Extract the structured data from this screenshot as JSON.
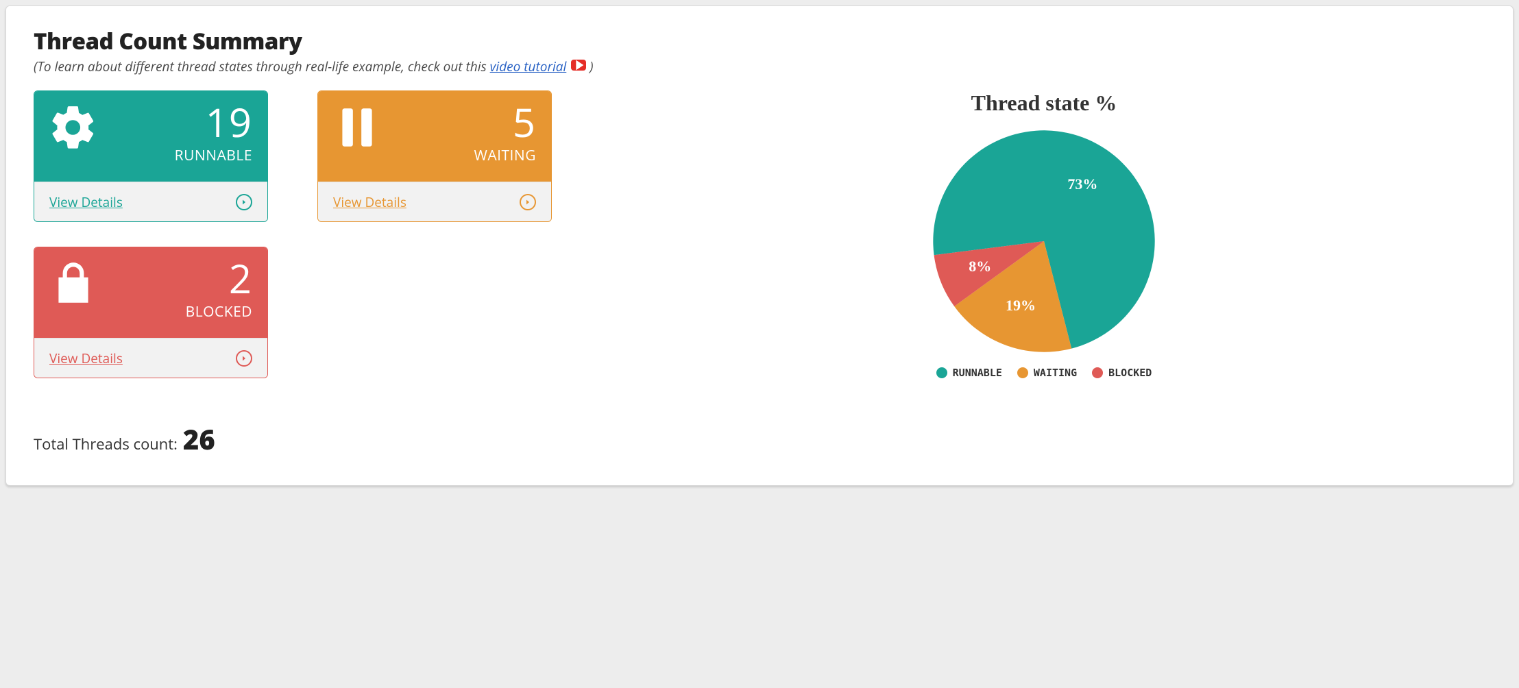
{
  "header": {
    "title": "Thread Count Summary",
    "subtitle_prefix": "(To learn about different thread states through real-life example, check out this ",
    "subtitle_link": "video tutorial",
    "subtitle_suffix": ")"
  },
  "colors": {
    "runnable": "#1aa596",
    "waiting": "#e79632",
    "blocked": "#df5a56"
  },
  "tiles": {
    "runnable": {
      "count": "19",
      "label": "RUNNABLE",
      "details": "View Details"
    },
    "waiting": {
      "count": "5",
      "label": "WAITING",
      "details": "View Details"
    },
    "blocked": {
      "count": "2",
      "label": "BLOCKED",
      "details": "View Details"
    }
  },
  "total": {
    "label": "Total Threads count:",
    "value": "26"
  },
  "chart_data": {
    "type": "pie",
    "title": "Thread state %",
    "series": [
      {
        "name": "RUNNABLE",
        "value": 73,
        "label": "73%",
        "color": "#1aa596"
      },
      {
        "name": "WAITING",
        "value": 19,
        "label": "19%",
        "color": "#e79632"
      },
      {
        "name": "BLOCKED",
        "value": 8,
        "label": "8%",
        "color": "#df5a56"
      }
    ],
    "legend": [
      "RUNNABLE",
      "WAITING",
      "BLOCKED"
    ]
  }
}
